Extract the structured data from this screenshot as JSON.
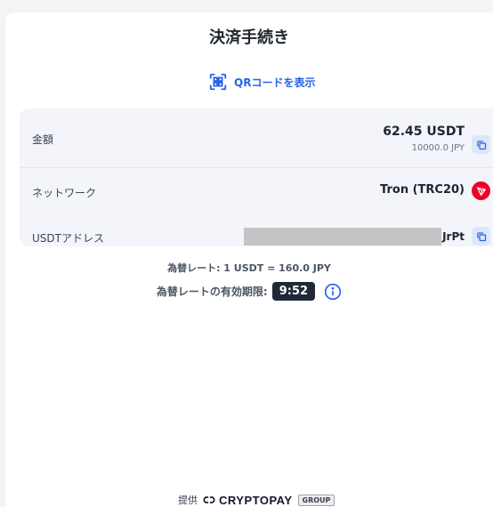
{
  "page": {
    "title": "決済手続き"
  },
  "qr": {
    "label": "QRコードを表示"
  },
  "amount": {
    "label": "金額",
    "value": "62.45 USDT",
    "sub_value": "10000.0 JPY"
  },
  "network": {
    "label": "ネットワーク",
    "value": "Tron (TRC20)"
  },
  "address": {
    "label": "USDTアドレス",
    "visible_suffix": "JrPt"
  },
  "rate": {
    "text": "為替レート: 1 USDT = 160.0 JPY"
  },
  "expiry": {
    "label": "為替レートの有効期限:",
    "timer": "9:52"
  },
  "footer": {
    "provided_by": "提供",
    "brand": "CRYPTOPAY",
    "badge": "GROUP"
  },
  "icons": {
    "qr": "qr-code-icon",
    "copy": "copy-icon",
    "tron": "tron-icon",
    "info": "info-icon",
    "logo": "cryptopay-logo-icon"
  },
  "colors": {
    "accent": "#2563eb",
    "tron": "#ef0027",
    "timer_bg": "#1f2937"
  }
}
